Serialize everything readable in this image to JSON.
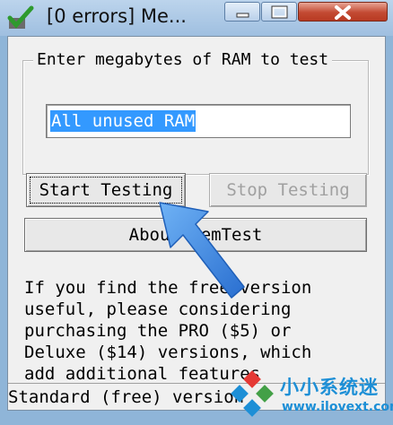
{
  "window": {
    "title": "[0 errors] Me...",
    "minimize_icon": "minimize-icon",
    "maximize_icon": "maximize-icon",
    "close_icon": "close-icon",
    "app_icon": "checkmark-app-icon"
  },
  "ram_group": {
    "legend": "Enter megabytes of RAM to test",
    "value": "All unused RAM"
  },
  "buttons": {
    "start": "Start Testing",
    "stop": "Stop Testing",
    "about": "About MemTest"
  },
  "info_text": "If you find the free version\nuseful, please considering\npurchasing the PRO ($5) or\nDeluxe ($14) versions, which\nadd additional features",
  "status": "Standard (free) version",
  "overlay": {
    "arrow_icon": "pointer-arrow-icon",
    "arrow_color": "#3a86e0"
  },
  "watermark": {
    "brand": "小小系统迷",
    "url": "www.ilovext.com",
    "color": "#1d8fd6"
  }
}
